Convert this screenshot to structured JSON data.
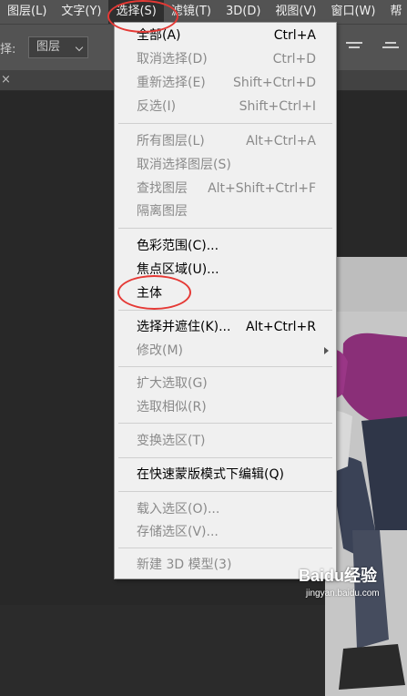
{
  "menubar": {
    "items": [
      "图层(L)",
      "文字(Y)",
      "选择(S)",
      "滤镜(T)",
      "3D(D)",
      "视图(V)",
      "窗口(W)",
      "帮"
    ],
    "active_index": 2
  },
  "options_bar": {
    "label": "择:",
    "select_value": "图层"
  },
  "tab_strip": {
    "close_glyph": "×"
  },
  "select_menu": {
    "items": [
      {
        "label": "全部(A)",
        "shortcut": "Ctrl+A",
        "enabled": true
      },
      {
        "label": "取消选择(D)",
        "shortcut": "Ctrl+D",
        "enabled": false
      },
      {
        "label": "重新选择(E)",
        "shortcut": "Shift+Ctrl+D",
        "enabled": false
      },
      {
        "label": "反选(I)",
        "shortcut": "Shift+Ctrl+I",
        "enabled": false
      },
      {
        "label": "所有图层(L)",
        "shortcut": "Alt+Ctrl+A",
        "enabled": false
      },
      {
        "label": "取消选择图层(S)",
        "shortcut": "",
        "enabled": false
      },
      {
        "label": "查找图层",
        "shortcut": "Alt+Shift+Ctrl+F",
        "enabled": false
      },
      {
        "label": "隔离图层",
        "shortcut": "",
        "enabled": false
      },
      {
        "label": "色彩范围(C)...",
        "shortcut": "",
        "enabled": true
      },
      {
        "label": "焦点区域(U)...",
        "shortcut": "",
        "enabled": true
      },
      {
        "label": "主体",
        "shortcut": "",
        "enabled": true
      },
      {
        "label": "选择并遮住(K)...",
        "shortcut": "Alt+Ctrl+R",
        "enabled": true
      },
      {
        "label": "修改(M)",
        "shortcut": "",
        "enabled": false,
        "submenu": true
      },
      {
        "label": "扩大选取(G)",
        "shortcut": "",
        "enabled": false
      },
      {
        "label": "选取相似(R)",
        "shortcut": "",
        "enabled": false
      },
      {
        "label": "变换选区(T)",
        "shortcut": "",
        "enabled": false
      },
      {
        "label": "在快速蒙版模式下编辑(Q)",
        "shortcut": "",
        "enabled": true
      },
      {
        "label": "载入选区(O)...",
        "shortcut": "",
        "enabled": false
      },
      {
        "label": "存储选区(V)...",
        "shortcut": "",
        "enabled": false
      },
      {
        "label": "新建 3D 模型(3)",
        "shortcut": "",
        "enabled": false
      }
    ]
  },
  "annotations": {
    "circled": [
      "选择(S)",
      "主体"
    ],
    "color": "#e53935"
  },
  "watermark": {
    "logo": "Baidu经验",
    "url": "jingyan.baidu.com"
  }
}
